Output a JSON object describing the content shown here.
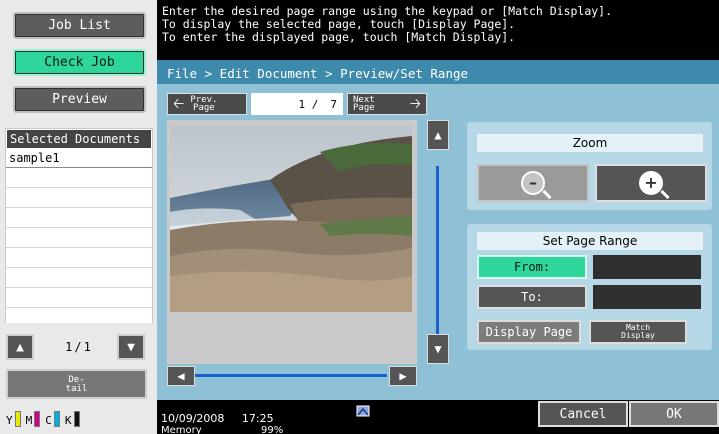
{
  "left": {
    "buttons": {
      "job_list": "Job List",
      "check_job": "Check Job",
      "preview": "Preview"
    },
    "selected_documents": {
      "header": "Selected Documents",
      "items": [
        "sample1"
      ]
    },
    "counter": {
      "current": "1",
      "separator": "/",
      "total": "1"
    },
    "detail_button": {
      "line1": "De-",
      "line2": "tail"
    },
    "toners": [
      {
        "label": "Y",
        "color": "#e8e800"
      },
      {
        "label": "M",
        "color": "#d0008a"
      },
      {
        "label": "C",
        "color": "#00b0e0"
      },
      {
        "label": "K",
        "color": "#111111"
      }
    ]
  },
  "message": {
    "lines": [
      "Enter the desired page range using the keypad or [Match Display].",
      "To display the selected page, touch [Display Page].",
      "To enter the displayed page, touch [Match Display]."
    ]
  },
  "main": {
    "breadcrumb": "File > Edit Document > Preview/Set Range",
    "prev_page": {
      "line1": "Prev.",
      "line2": "Page"
    },
    "next_page": {
      "line1": "Next",
      "line2": "Page"
    },
    "page": {
      "current": "1 /",
      "total": "7"
    }
  },
  "zoom": {
    "title": "Zoom"
  },
  "set_page_range": {
    "title": "Set Page Range",
    "from_label": "From:",
    "to_label": "To:",
    "display_page": "Display Page",
    "match_display": {
      "line1": "Match",
      "line2": "Display"
    }
  },
  "status": {
    "date": "10/09/2008",
    "time": "17:25",
    "memory_label": "Memory",
    "memory_value": "99%",
    "cancel": "Cancel",
    "ok": "OK"
  },
  "colors": {
    "accent_green": "#2fd69b",
    "panel_blue": "#3e8aad",
    "inner_blue": "#8ec0d6",
    "scroll_blue": "#1a5fd0"
  }
}
